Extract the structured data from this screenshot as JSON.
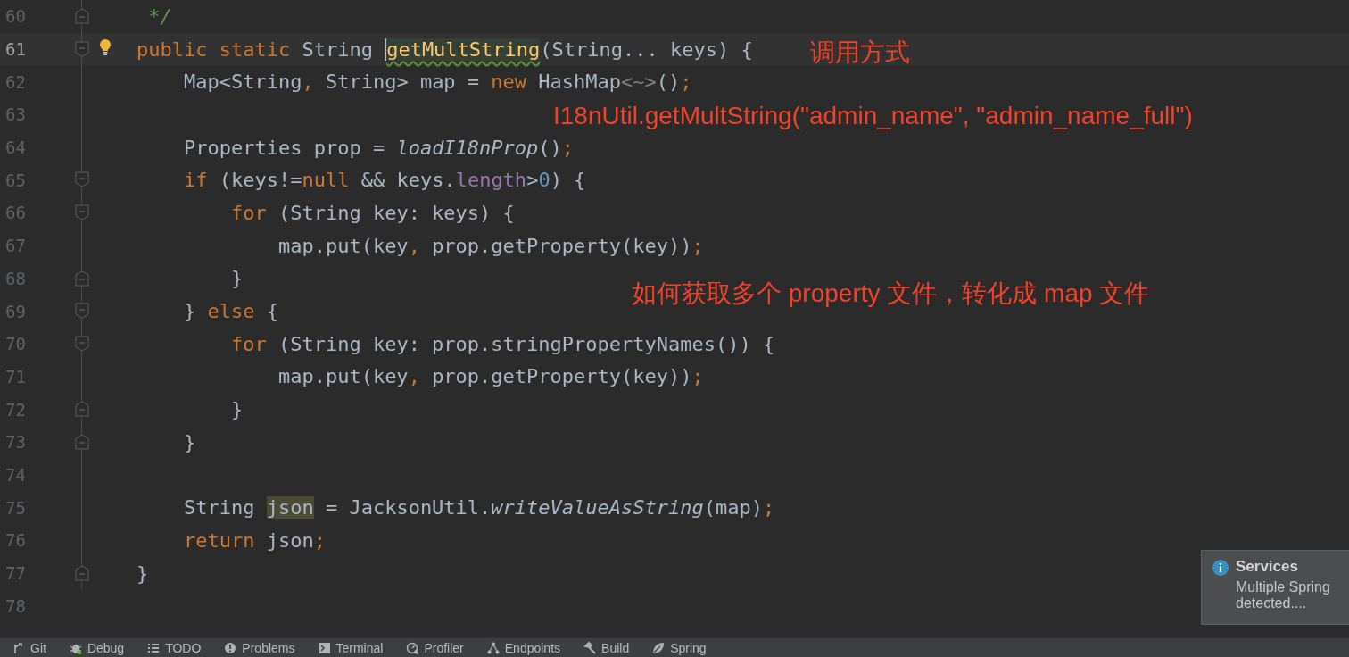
{
  "editor": {
    "lines": [
      {
        "number": "60",
        "kind": "fold-end",
        "current": false,
        "tokens": [
          {
            "text": "     */",
            "kind": "comment"
          }
        ]
      },
      {
        "number": "61",
        "kind": "fold-start",
        "current": true,
        "bulb": true,
        "tokens": [
          {
            "text": "    public static ",
            "kind": "keyword"
          },
          {
            "text": "String ",
            "kind": "plain"
          },
          {
            "text": "getMultString",
            "kind": "method-decl"
          },
          {
            "text": "(String... keys) {",
            "kind": "plain"
          }
        ]
      },
      {
        "number": "62",
        "kind": "plain",
        "current": false,
        "tokens": [
          {
            "text": "        Map<String",
            "kind": "plain"
          },
          {
            "text": ", ",
            "kind": "keyword"
          },
          {
            "text": "String> map = ",
            "kind": "plain"
          },
          {
            "text": "new ",
            "kind": "keyword"
          },
          {
            "text": "HashMap",
            "kind": "plain"
          },
          {
            "text": "<~>",
            "kind": "folded"
          },
          {
            "text": "()",
            "kind": "plain"
          },
          {
            "text": ";",
            "kind": "keyword"
          }
        ]
      },
      {
        "number": "63",
        "kind": "plain",
        "current": false
      },
      {
        "number": "64",
        "kind": "plain",
        "current": false,
        "tokens": [
          {
            "text": "        Properties prop = ",
            "kind": "plain"
          },
          {
            "text": "loadI18nProp",
            "kind": "static-call"
          },
          {
            "text": "()",
            "kind": "plain"
          },
          {
            "text": ";",
            "kind": "keyword"
          }
        ]
      },
      {
        "number": "65",
        "kind": "fold-start",
        "current": false,
        "tokens": [
          {
            "text": "        if ",
            "kind": "keyword"
          },
          {
            "text": "(keys!=",
            "kind": "plain"
          },
          {
            "text": "null ",
            "kind": "keyword"
          },
          {
            "text": "&& keys.",
            "kind": "plain"
          },
          {
            "text": "length",
            "kind": "field"
          },
          {
            "text": ">",
            "kind": "plain"
          },
          {
            "text": "0",
            "kind": "number"
          },
          {
            "text": ") {",
            "kind": "plain"
          }
        ]
      },
      {
        "number": "66",
        "kind": "fold-start",
        "current": false,
        "tokens": [
          {
            "text": "            for ",
            "kind": "keyword"
          },
          {
            "text": "(String key: keys) {",
            "kind": "plain"
          }
        ]
      },
      {
        "number": "67",
        "kind": "plain",
        "current": false,
        "tokens": [
          {
            "text": "                map.put(key",
            "kind": "plain"
          },
          {
            "text": ", ",
            "kind": "keyword"
          },
          {
            "text": "prop.getProperty(key))",
            "kind": "plain"
          },
          {
            "text": ";",
            "kind": "keyword"
          }
        ]
      },
      {
        "number": "68",
        "kind": "fold-end",
        "current": false,
        "tokens": [
          {
            "text": "            }",
            "kind": "plain"
          }
        ]
      },
      {
        "number": "69",
        "kind": "fold-start",
        "current": false,
        "tokens": [
          {
            "text": "        } ",
            "kind": "plain"
          },
          {
            "text": "else ",
            "kind": "keyword"
          },
          {
            "text": "{",
            "kind": "plain"
          }
        ]
      },
      {
        "number": "70",
        "kind": "fold-start",
        "current": false,
        "tokens": [
          {
            "text": "            for ",
            "kind": "keyword"
          },
          {
            "text": "(String key: prop.stringPropertyNames()) {",
            "kind": "plain"
          }
        ]
      },
      {
        "number": "71",
        "kind": "plain",
        "current": false,
        "tokens": [
          {
            "text": "                map.put(key",
            "kind": "plain"
          },
          {
            "text": ", ",
            "kind": "keyword"
          },
          {
            "text": "prop.getProperty(key))",
            "kind": "plain"
          },
          {
            "text": ";",
            "kind": "keyword"
          }
        ]
      },
      {
        "number": "72",
        "kind": "fold-end",
        "current": false,
        "tokens": [
          {
            "text": "            }",
            "kind": "plain"
          }
        ]
      },
      {
        "number": "73",
        "kind": "fold-end",
        "current": false,
        "tokens": [
          {
            "text": "        }",
            "kind": "plain"
          }
        ]
      },
      {
        "number": "74",
        "kind": "plain",
        "current": false
      },
      {
        "number": "75",
        "kind": "plain",
        "current": false,
        "tokens": [
          {
            "text": "        String ",
            "kind": "plain"
          },
          {
            "text": "json",
            "kind": "usage-highlight"
          },
          {
            "text": " = JacksonUtil.",
            "kind": "plain"
          },
          {
            "text": "writeValueAsString",
            "kind": "static-call"
          },
          {
            "text": "(map)",
            "kind": "plain"
          },
          {
            "text": ";",
            "kind": "keyword"
          }
        ]
      },
      {
        "number": "76",
        "kind": "plain",
        "current": false,
        "tokens": [
          {
            "text": "        return ",
            "kind": "keyword"
          },
          {
            "text": "json",
            "kind": "plain"
          },
          {
            "text": ";",
            "kind": "keyword"
          }
        ]
      },
      {
        "number": "77",
        "kind": "fold-end",
        "current": false,
        "tokens": [
          {
            "text": "    }",
            "kind": "plain"
          }
        ]
      },
      {
        "number": "78",
        "kind": "plain",
        "current": false
      }
    ]
  },
  "annotations": [
    {
      "text": "调用方式"
    },
    {
      "text": "I18nUtil.getMultString(\"admin_name\", \"admin_name_full\")"
    },
    {
      "text": "如何获取多个 property 文件，转化成 map 文件"
    }
  ],
  "notification": {
    "title": "Services",
    "message": "Multiple Spring detected...."
  },
  "tool_windows": [
    {
      "label": "Git"
    },
    {
      "label": "Debug"
    },
    {
      "label": "TODO"
    },
    {
      "label": "Problems"
    },
    {
      "label": "Terminal"
    },
    {
      "label": "Profiler"
    },
    {
      "label": "Endpoints"
    },
    {
      "label": "Build"
    },
    {
      "label": "Spring"
    }
  ]
}
